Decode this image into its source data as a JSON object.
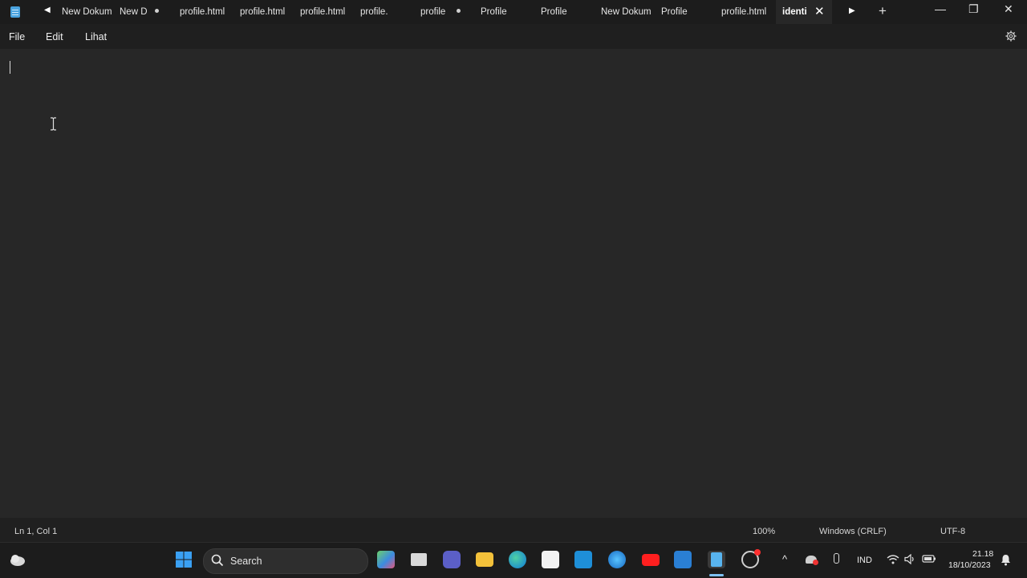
{
  "tabs": [
    {
      "label": "New Dokum",
      "modified": false
    },
    {
      "label": "New D",
      "modified": true
    },
    {
      "label": "profile.html",
      "modified": false
    },
    {
      "label": "profile.html",
      "modified": false
    },
    {
      "label": "profile.html",
      "modified": false
    },
    {
      "label": "profile.",
      "modified": false
    },
    {
      "label": "profile",
      "modified": true
    },
    {
      "label": "Profile",
      "modified": false
    },
    {
      "label": "Profile",
      "modified": false
    },
    {
      "label": "New Dokum",
      "modified": false
    },
    {
      "label": "Profile",
      "modified": false
    },
    {
      "label": "profile.html",
      "modified": false
    },
    {
      "label": "identi",
      "modified": false,
      "active": true
    }
  ],
  "window_controls": {
    "minimize": "—",
    "maximize": "❐",
    "close": "✕"
  },
  "menu": {
    "file": "File",
    "edit": "Edit",
    "view": "Lihat"
  },
  "status": {
    "position": "Ln 1, Col 1",
    "zoom": "100%",
    "line_ending": "Windows (CRLF)",
    "encoding": "UTF-8"
  },
  "taskbar": {
    "search_label": "Search",
    "language": "IND",
    "time": "21.18",
    "date": "18/10/2023"
  },
  "icons": {
    "tab_scroll_left": "caret-left-icon",
    "tab_scroll_right": "caret-right-icon",
    "tab_close": "close-icon",
    "tab_add": "plus-icon",
    "settings": "gear-icon"
  },
  "colors": {
    "editor_bg": "#272727",
    "titlebar_bg": "#1c1c1c",
    "menubar_bg": "#1f1f1f",
    "accent_notepad": "#4aa3df"
  }
}
